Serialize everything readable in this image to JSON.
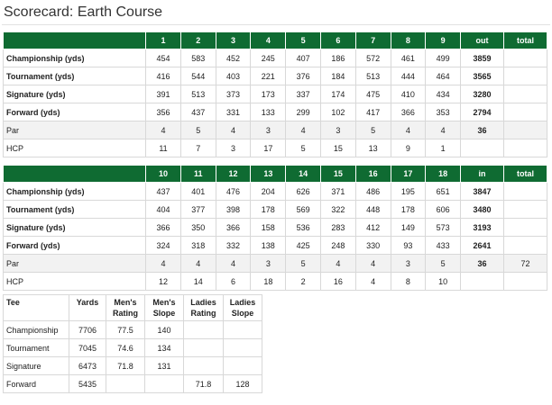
{
  "title": "Scorecard: Earth Course",
  "front": {
    "headers": [
      "1",
      "2",
      "3",
      "4",
      "5",
      "6",
      "7",
      "8",
      "9",
      "out",
      "total"
    ],
    "rows": [
      {
        "label": "Championship (yds)",
        "values": [
          "454",
          "583",
          "452",
          "245",
          "407",
          "186",
          "572",
          "461",
          "499",
          "3859",
          ""
        ]
      },
      {
        "label": "Tournament (yds)",
        "values": [
          "416",
          "544",
          "403",
          "221",
          "376",
          "184",
          "513",
          "444",
          "464",
          "3565",
          ""
        ]
      },
      {
        "label": "Signature (yds)",
        "values": [
          "391",
          "513",
          "373",
          "173",
          "337",
          "174",
          "475",
          "410",
          "434",
          "3280",
          ""
        ]
      },
      {
        "label": "Forward (yds)",
        "values": [
          "356",
          "437",
          "331",
          "133",
          "299",
          "102",
          "417",
          "366",
          "353",
          "2794",
          ""
        ]
      },
      {
        "label": "Par",
        "values": [
          "4",
          "5",
          "4",
          "3",
          "4",
          "3",
          "5",
          "4",
          "4",
          "36",
          ""
        ]
      },
      {
        "label": "HCP",
        "values": [
          "11",
          "7",
          "3",
          "17",
          "5",
          "15",
          "13",
          "9",
          "1",
          "",
          ""
        ]
      }
    ]
  },
  "back": {
    "headers": [
      "10",
      "11",
      "12",
      "13",
      "14",
      "15",
      "16",
      "17",
      "18",
      "in",
      "total"
    ],
    "rows": [
      {
        "label": "Championship (yds)",
        "values": [
          "437",
          "401",
          "476",
          "204",
          "626",
          "371",
          "486",
          "195",
          "651",
          "3847",
          ""
        ]
      },
      {
        "label": "Tournament (yds)",
        "values": [
          "404",
          "377",
          "398",
          "178",
          "569",
          "322",
          "448",
          "178",
          "606",
          "3480",
          ""
        ]
      },
      {
        "label": "Signature (yds)",
        "values": [
          "366",
          "350",
          "366",
          "158",
          "536",
          "283",
          "412",
          "149",
          "573",
          "3193",
          ""
        ]
      },
      {
        "label": "Forward (yds)",
        "values": [
          "324",
          "318",
          "332",
          "138",
          "425",
          "248",
          "330",
          "93",
          "433",
          "2641",
          ""
        ]
      },
      {
        "label": "Par",
        "values": [
          "4",
          "4",
          "4",
          "3",
          "5",
          "4",
          "4",
          "3",
          "5",
          "36",
          "72"
        ]
      },
      {
        "label": "HCP",
        "values": [
          "12",
          "14",
          "6",
          "18",
          "2",
          "16",
          "4",
          "8",
          "10",
          "",
          ""
        ]
      }
    ]
  },
  "tees": {
    "headers": [
      "Tee",
      "Yards",
      "Men's Rating",
      "Men's Slope",
      "Ladies Rating",
      "Ladies Slope"
    ],
    "rows": [
      [
        "Championship",
        "7706",
        "77.5",
        "140",
        "",
        ""
      ],
      [
        "Tournament",
        "7045",
        "74.6",
        "134",
        "",
        ""
      ],
      [
        "Signature",
        "6473",
        "71.8",
        "131",
        "",
        ""
      ],
      [
        "Forward",
        "5435",
        "",
        "",
        "71.8",
        "128"
      ]
    ]
  }
}
